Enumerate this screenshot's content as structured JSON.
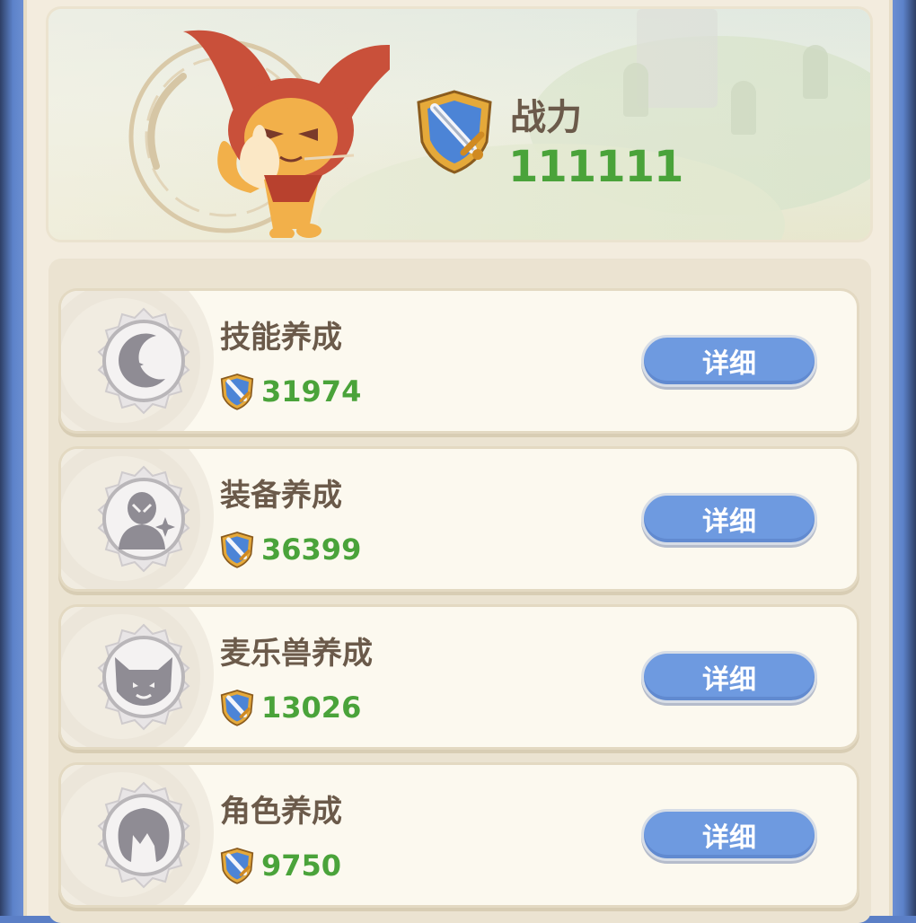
{
  "header": {
    "power_label": "战力",
    "power_value": "111111"
  },
  "cards": [
    {
      "title": "技能养成",
      "value": "31974",
      "button_label": "详细",
      "icon": "moon-star-icon"
    },
    {
      "title": "装备养成",
      "value": "36399",
      "button_label": "详细",
      "icon": "figure-sparkle-icon"
    },
    {
      "title": "麦乐兽养成",
      "value": "13026",
      "button_label": "详细",
      "icon": "cat-face-icon"
    },
    {
      "title": "角色养成",
      "value": "9750",
      "button_label": "详细",
      "icon": "character-head-icon"
    }
  ],
  "colors": {
    "accent_blue": "#6e9ae0",
    "value_green": "#4aa33a",
    "title_brown": "#6b5a4a",
    "panel_bg": "#f3ecde"
  }
}
